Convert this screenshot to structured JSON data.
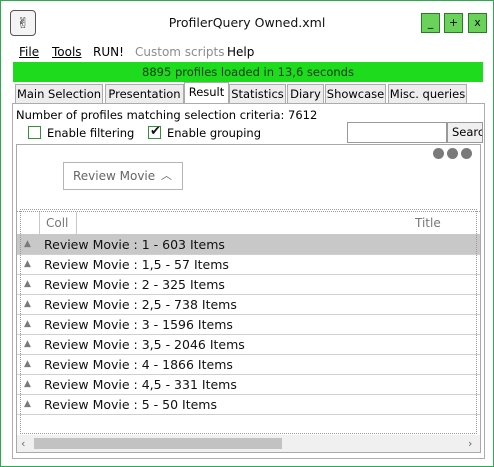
{
  "window": {
    "title": "ProfilerQuery Owned.xml",
    "buttons": {
      "minimize": "_",
      "maximize": "+",
      "close": "x"
    }
  },
  "menu": {
    "file": "File",
    "tools": "Tools",
    "run": "RUN!",
    "custom_scripts": "Custom scripts",
    "help": "Help"
  },
  "status": "8895 profiles loaded in 13,6 seconds",
  "tabs": [
    {
      "label": "Main Selection"
    },
    {
      "label": "Presentation"
    },
    {
      "label": "Result"
    },
    {
      "label": "Statistics"
    },
    {
      "label": "Diary"
    },
    {
      "label": "Showcase"
    },
    {
      "label": "Misc. queries"
    }
  ],
  "active_tab": "Result",
  "result": {
    "count_line": "Number of profiles matching selection criteria: 7612",
    "enable_filtering": {
      "label": "Enable filtering",
      "checked": false
    },
    "enable_grouping": {
      "label": "Enable grouping",
      "checked": true
    },
    "search": {
      "value": "",
      "button_label": "Searc"
    }
  },
  "grid": {
    "group_chip": "Review Movie",
    "columns": {
      "collection": "Coll",
      "title": "Title"
    },
    "rows": [
      "Review Movie : 1 - 603 Items",
      "Review Movie : 1,5 - 57 Items",
      "Review Movie : 2 - 325 Items",
      "Review Movie : 2,5 - 738 Items",
      "Review Movie : 3 - 1596 Items",
      "Review Movie : 3,5 - 2046 Items",
      "Review Movie : 4 - 1866 Items",
      "Review Movie : 4,5 - 331 Items",
      "Review Movie : 5 - 50 Items"
    ]
  },
  "colors": {
    "status_bg": "#1edb1e",
    "window_button": "#6ad25a",
    "selected_row": "#c8c8c8"
  }
}
